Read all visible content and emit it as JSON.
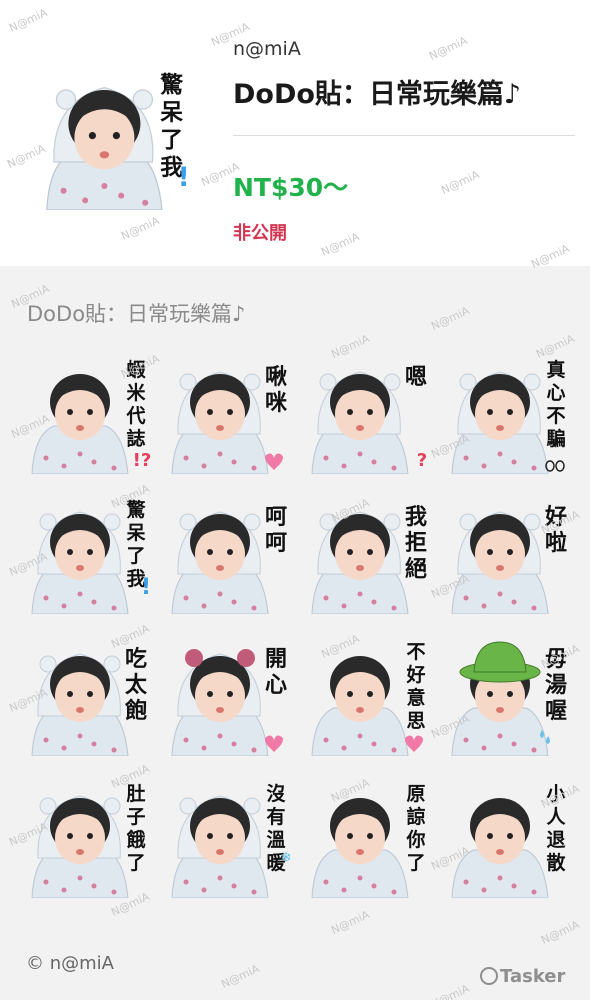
{
  "header": {
    "author": "n@miA",
    "title": "DoDo貼：日常玩樂篇♪",
    "price": "NT$30〜",
    "status": "非公開",
    "main_sticker_caption": [
      "驚",
      "呆",
      "了",
      "我"
    ]
  },
  "section": {
    "title": "DoDo貼：日常玩樂篇♪"
  },
  "stickers": [
    {
      "caption": [
        "蝦",
        "米",
        "代",
        "誌"
      ],
      "extra": "!?",
      "hood": "none"
    },
    {
      "caption": [
        "啾",
        "咪"
      ],
      "extra": "heart",
      "hood": "bear"
    },
    {
      "caption": [
        "嗯"
      ],
      "extra": "?",
      "hood": "bear"
    },
    {
      "caption": [
        "真",
        "心",
        "不",
        "騙"
      ],
      "extra": "oo",
      "hood": "bear"
    },
    {
      "caption": [
        "驚",
        "呆",
        "了",
        "我"
      ],
      "extra": "!",
      "hood": "bear"
    },
    {
      "caption": [
        "呵",
        "呵"
      ],
      "extra": "",
      "hood": "bear"
    },
    {
      "caption": [
        "我",
        "拒",
        "絕"
      ],
      "extra": "",
      "hood": "bear"
    },
    {
      "caption": [
        "好",
        "啦"
      ],
      "extra": "",
      "hood": "bear"
    },
    {
      "caption": [
        "吃",
        "太",
        "飽"
      ],
      "extra": "",
      "hood": "bear"
    },
    {
      "caption": [
        "開",
        "心"
      ],
      "extra": "heart",
      "hood": "ears"
    },
    {
      "caption": [
        "不",
        "好",
        "意",
        "思"
      ],
      "extra": "heart",
      "hood": "none"
    },
    {
      "caption": [
        "毋",
        "湯",
        "喔"
      ],
      "extra": "sweat",
      "hood": "hat"
    },
    {
      "caption": [
        "肚",
        "子",
        "餓",
        "了"
      ],
      "extra": "",
      "hood": "bear"
    },
    {
      "caption": [
        "沒",
        "有",
        "溫",
        "暖"
      ],
      "extra": "snow",
      "hood": "bear"
    },
    {
      "caption": [
        "原",
        "諒",
        "你",
        "了"
      ],
      "extra": "",
      "hood": "none"
    },
    {
      "caption": [
        "小",
        "人",
        "退",
        "散"
      ],
      "extra": "",
      "hood": "none"
    }
  ],
  "footer": {
    "copyright": "© n@miA",
    "brand": "Tasker"
  },
  "watermark": "N@miA",
  "colors": {
    "price_green": "#22b24c",
    "status_red": "#d23552",
    "heart_pink": "#f07aa5",
    "question_red": "#e5405e",
    "exclaim_blue": "#3aa0e8",
    "hat_green": "#6ab547"
  }
}
